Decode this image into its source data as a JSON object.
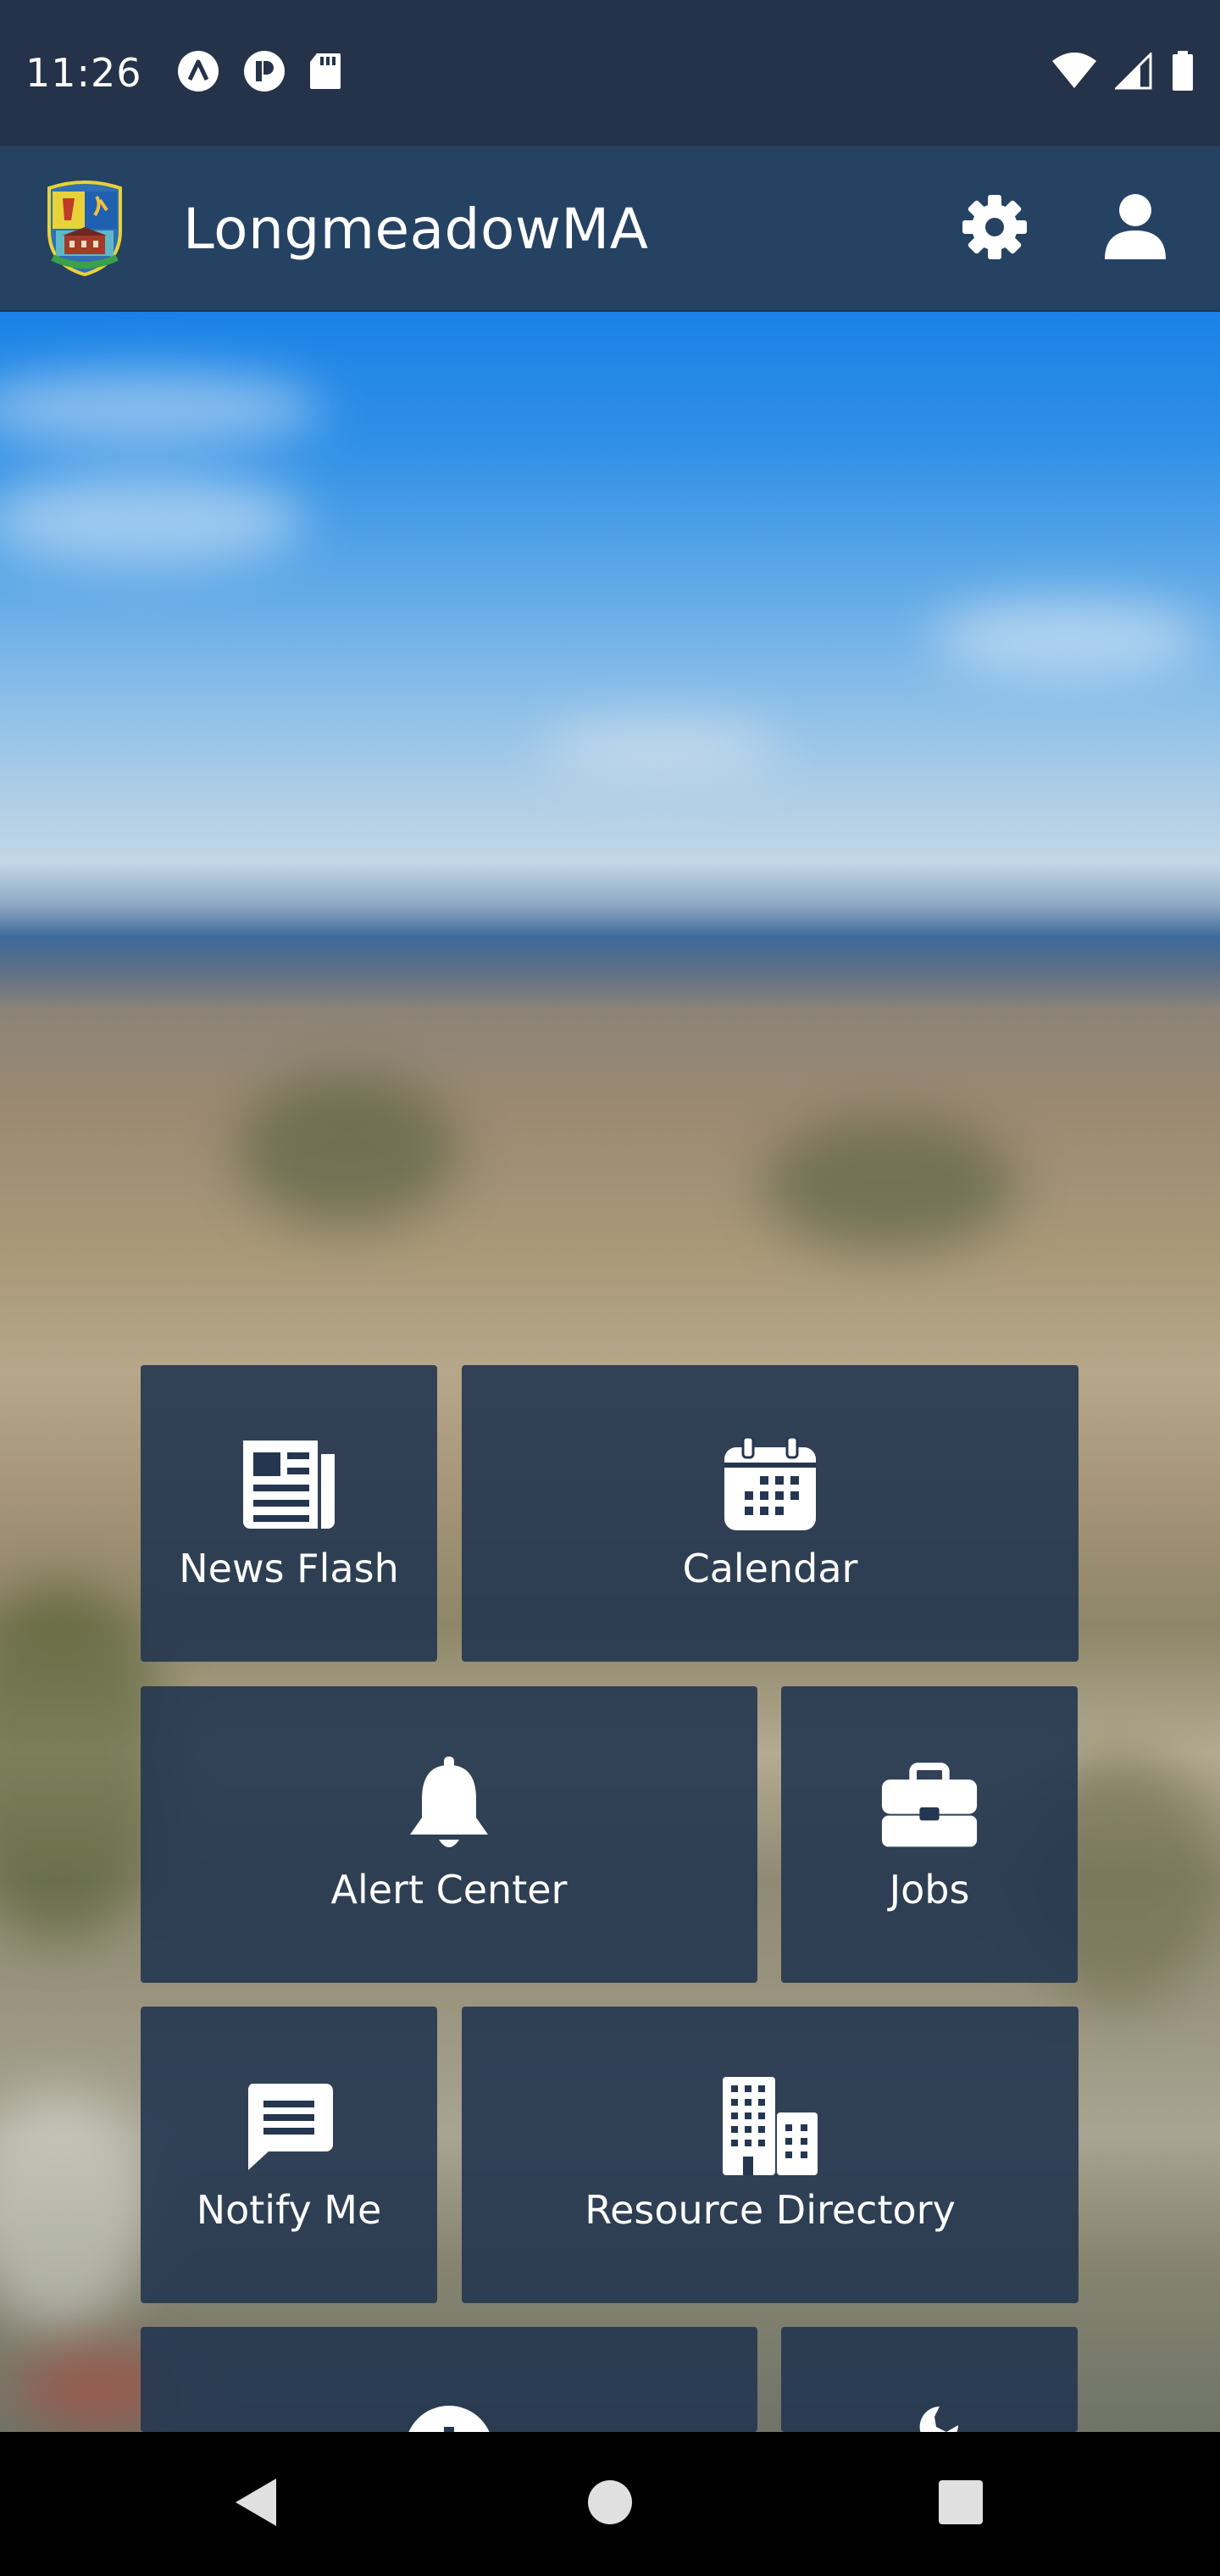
{
  "status_bar": {
    "time": "11:26",
    "left_icons": [
      "arch-icon",
      "p-icon",
      "sd-card-icon"
    ],
    "right_icons": [
      "wifi-icon",
      "cell-signal-icon",
      "battery-icon"
    ]
  },
  "app_bar": {
    "title": "LongmeadowMA",
    "logo": "town-seal-logo",
    "actions": [
      "settings-icon",
      "profile-icon"
    ]
  },
  "tiles": [
    {
      "label": "News Flash",
      "icon": "newspaper-icon"
    },
    {
      "label": "Calendar",
      "icon": "calendar-icon"
    },
    {
      "label": "Alert Center",
      "icon": "bell-icon"
    },
    {
      "label": "Jobs",
      "icon": "briefcase-icon"
    },
    {
      "label": "Notify Me",
      "icon": "message-icon"
    },
    {
      "label": "Resource Directory",
      "icon": "buildings-icon"
    },
    {
      "label": "",
      "icon": "plus-circle-icon"
    },
    {
      "label": "",
      "icon": "wrench-icon"
    }
  ],
  "nav_bar": {
    "buttons": [
      "back-icon",
      "home-icon",
      "recents-icon"
    ]
  },
  "colors": {
    "status_bar_bg": "#243349",
    "app_bar_bg": "#264262",
    "tile_bg": "#243650"
  }
}
